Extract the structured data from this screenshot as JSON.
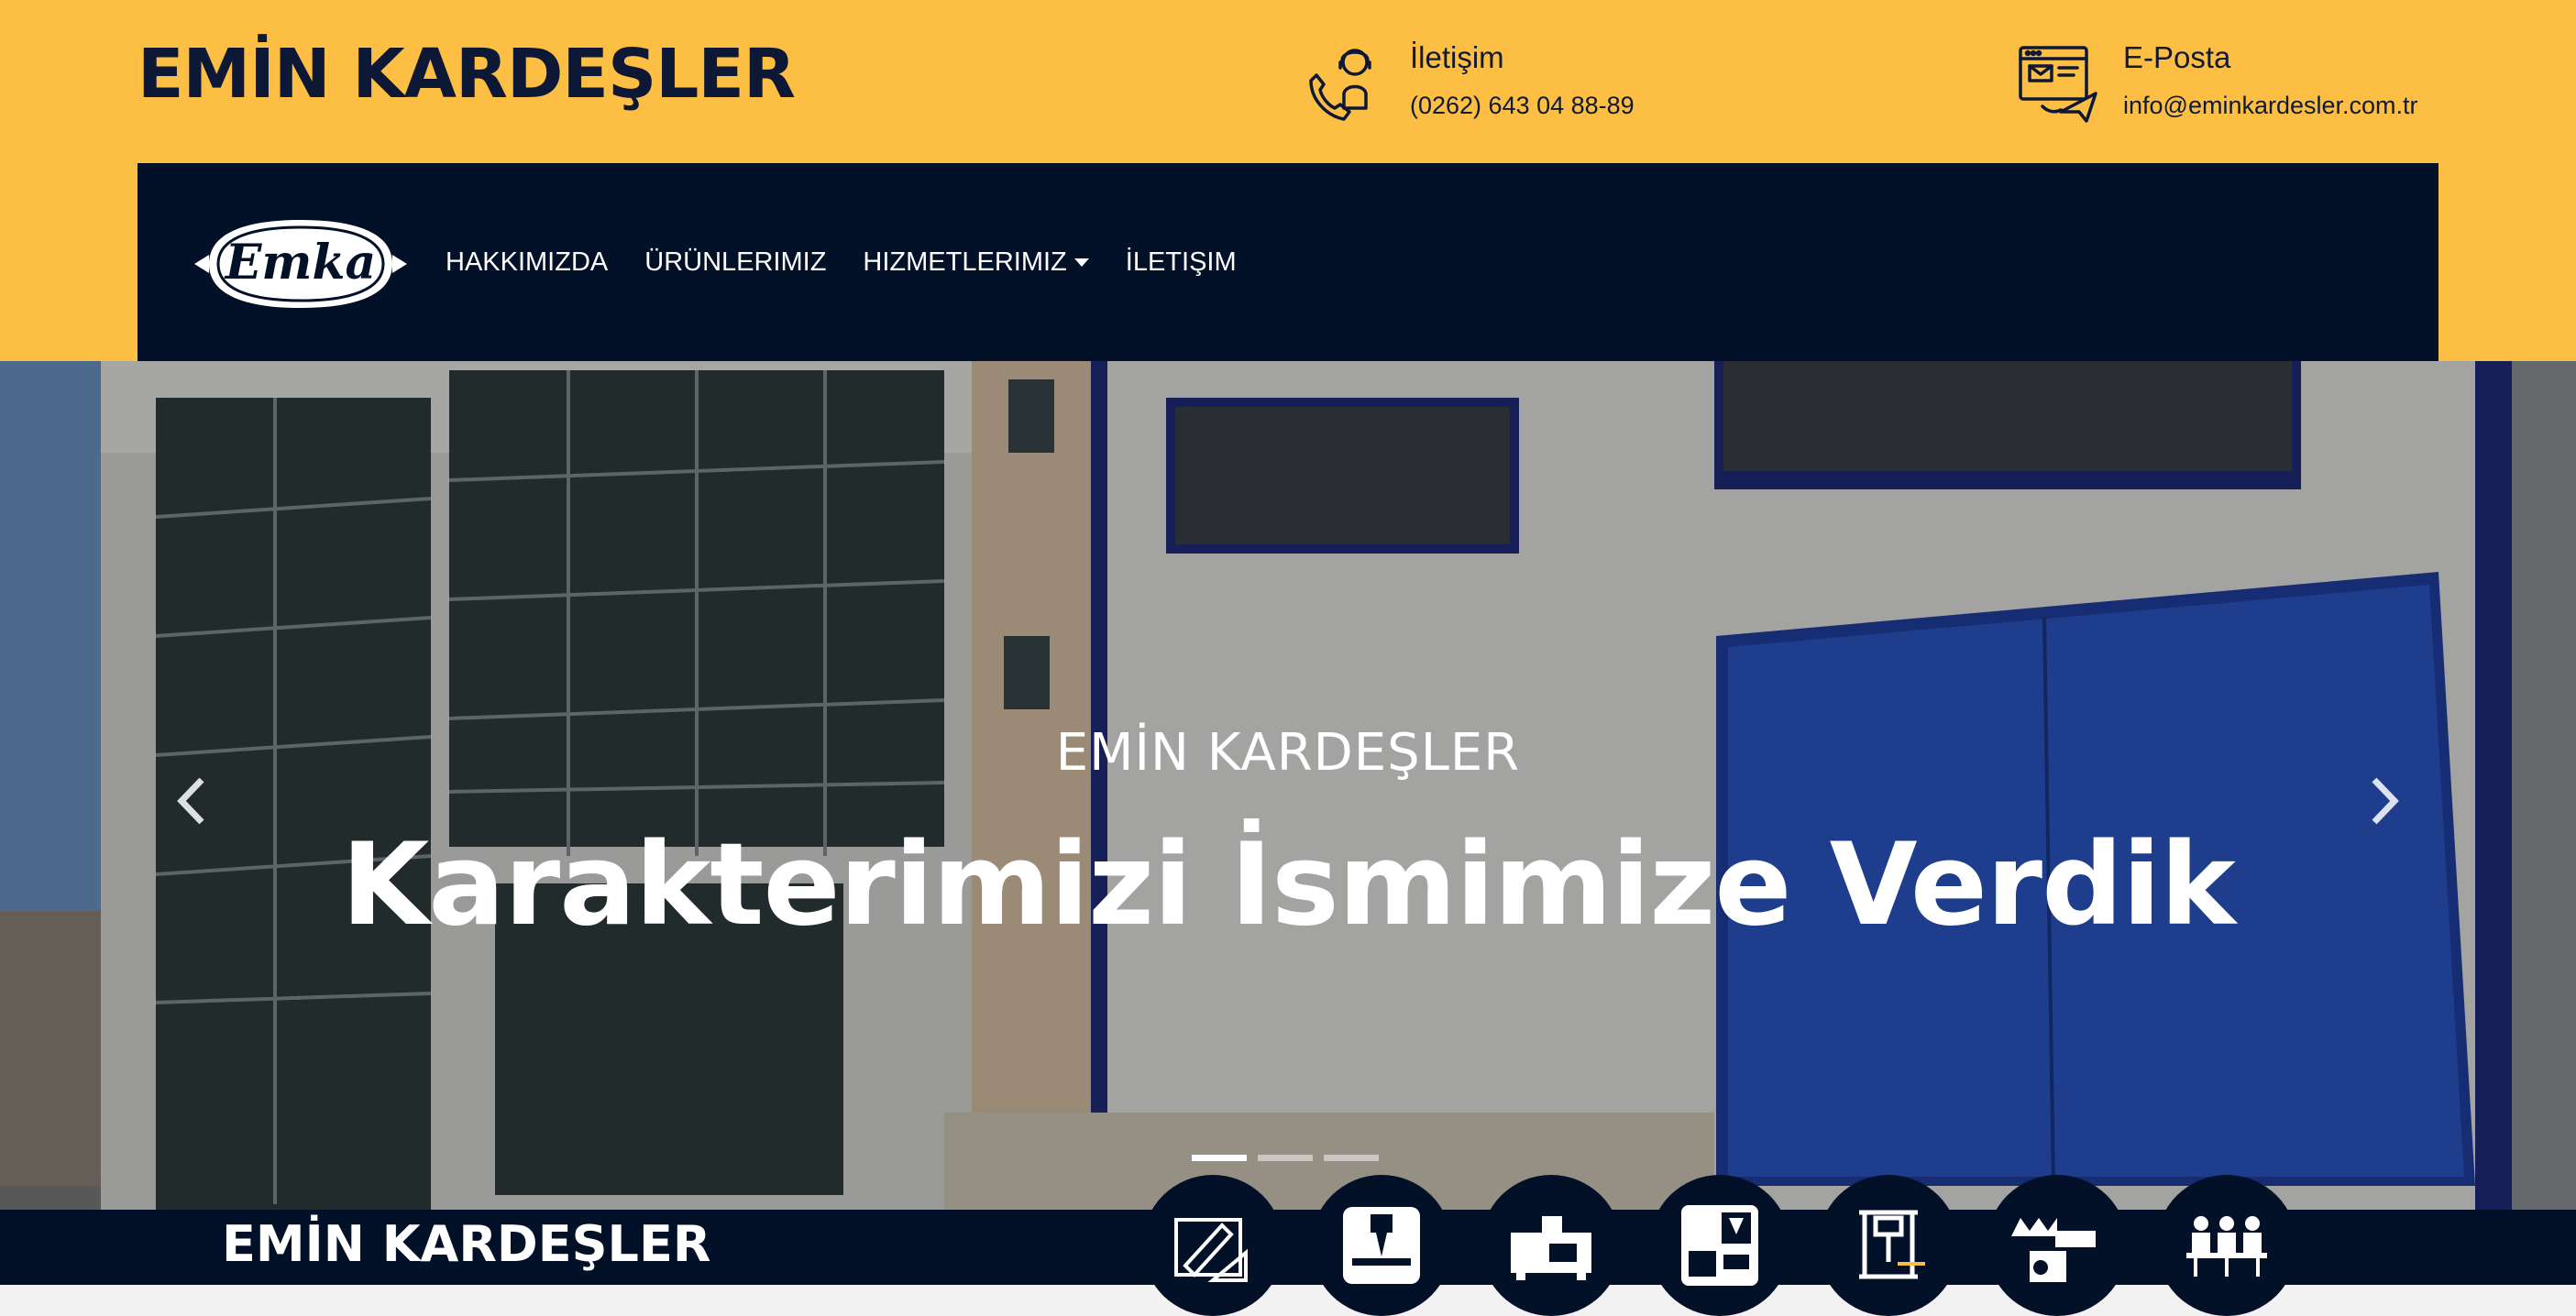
{
  "header": {
    "brand": "EMİN KARDEŞLER",
    "contact": {
      "label": "İletişim",
      "phone": "(0262) 643 04 88-89",
      "icon": "phone-support-icon"
    },
    "email": {
      "label": "E-Posta",
      "address": "info@eminkardesler.com.tr",
      "icon": "email-icon"
    }
  },
  "nav": {
    "logo_text": "Emka",
    "items": [
      {
        "label": "HAKKIMIZDA"
      },
      {
        "label": "ÜRÜNLERIMIZ"
      },
      {
        "label": "HIZMETLERIMIZ"
      },
      {
        "label": "İLETIŞIM"
      }
    ]
  },
  "hero": {
    "subtitle": "EMİN KARDEŞLER",
    "title": "Karakterimizi İsmimize Verdik",
    "slides": 3,
    "active_slide": 1
  },
  "footer_band": {
    "brand": "EMİN KARDEŞLER",
    "services": [
      {
        "icon": "design-drawing-icon"
      },
      {
        "icon": "cnc-milling-icon"
      },
      {
        "icon": "cnc-lathe-icon"
      },
      {
        "icon": "machining-center-icon"
      },
      {
        "icon": "press-machine-icon"
      },
      {
        "icon": "welding-machine-icon"
      },
      {
        "icon": "team-workers-icon"
      }
    ]
  },
  "colors": {
    "accent": "#fdbf43",
    "navy": "#021028"
  }
}
